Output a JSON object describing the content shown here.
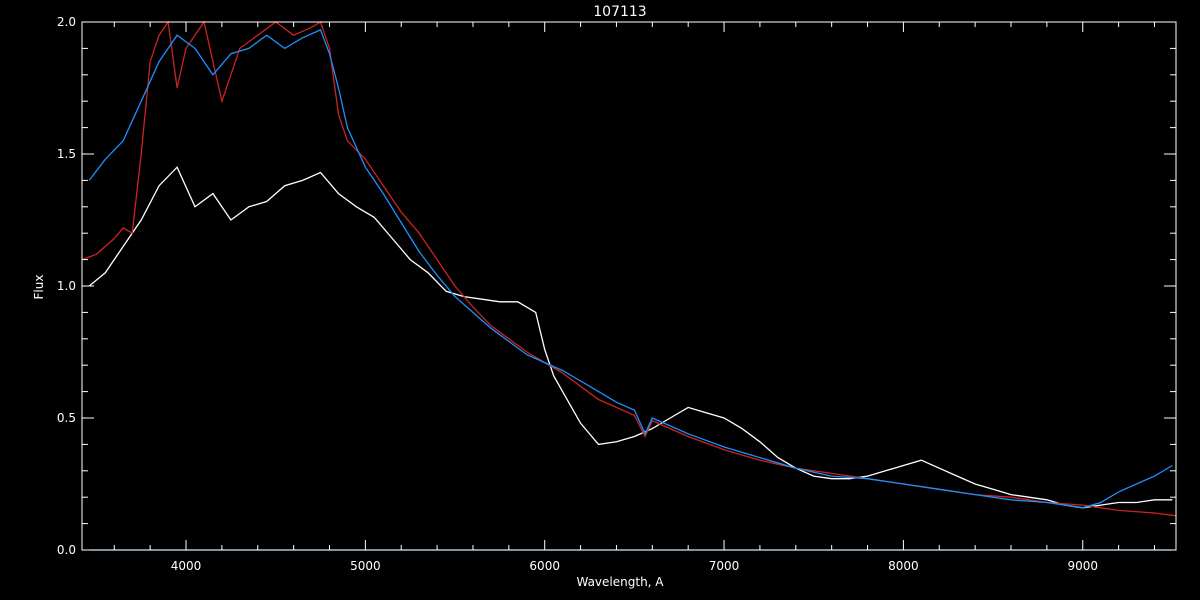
{
  "chart_data": {
    "type": "line",
    "title": "107113",
    "xlabel": "Wavelength, A",
    "ylabel": "Flux",
    "xlim": [
      3420,
      9520
    ],
    "ylim": [
      0.0,
      2.0
    ],
    "xticks": [
      4000,
      5000,
      6000,
      7000,
      8000,
      9000
    ],
    "xtick_labels": [
      "4000",
      "5000",
      "6000",
      "7000",
      "8000",
      "9000"
    ],
    "yticks": [
      0.0,
      0.5,
      1.0,
      1.5,
      2.0
    ],
    "ytick_labels": [
      "0.0",
      "0.5",
      "1.0",
      "1.5",
      "2.0"
    ],
    "grid": false,
    "background": "#000000",
    "series": [
      {
        "color": "#ffffff",
        "x": [
          3460,
          3550,
          3650,
          3750,
          3850,
          3950,
          4050,
          4150,
          4250,
          4350,
          4450,
          4550,
          4650,
          4750,
          4850,
          4950,
          5050,
          5150,
          5250,
          5350,
          5450,
          5550,
          5650,
          5750,
          5850,
          5950,
          6000,
          6050,
          6100,
          6200,
          6300,
          6400,
          6500,
          6600,
          6700,
          6800,
          6900,
          7000,
          7100,
          7200,
          7300,
          7400,
          7500,
          7600,
          7700,
          7800,
          7900,
          8000,
          8100,
          8200,
          8300,
          8400,
          8500,
          8600,
          8700,
          8800,
          8900,
          9000,
          9100,
          9200,
          9300,
          9400,
          9500
        ],
        "y": [
          1.0,
          1.05,
          1.15,
          1.25,
          1.38,
          1.45,
          1.3,
          1.35,
          1.25,
          1.3,
          1.32,
          1.38,
          1.4,
          1.43,
          1.35,
          1.3,
          1.26,
          1.18,
          1.1,
          1.05,
          0.98,
          0.96,
          0.95,
          0.94,
          0.94,
          0.9,
          0.76,
          0.66,
          0.6,
          0.48,
          0.4,
          0.41,
          0.43,
          0.46,
          0.5,
          0.54,
          0.52,
          0.5,
          0.46,
          0.41,
          0.35,
          0.31,
          0.28,
          0.27,
          0.27,
          0.28,
          0.3,
          0.32,
          0.34,
          0.31,
          0.28,
          0.25,
          0.23,
          0.21,
          0.2,
          0.19,
          0.17,
          0.16,
          0.17,
          0.18,
          0.18,
          0.19,
          0.19
        ]
      },
      {
        "color": "#cc2222",
        "x": [
          3420,
          3500,
          3550,
          3600,
          3650,
          3700,
          3750,
          3800,
          3850,
          3900,
          3950,
          4000,
          4100,
          4200,
          4300,
          4400,
          4500,
          4600,
          4700,
          4750,
          4800,
          4850,
          4900,
          5000,
          5100,
          5200,
          5300,
          5400,
          5500,
          5600,
          5700,
          5800,
          5900,
          6000,
          6100,
          6200,
          6300,
          6400,
          6500,
          6560,
          6600,
          6700,
          6800,
          7000,
          7200,
          7400,
          7600,
          7800,
          8000,
          8200,
          8400,
          8600,
          8800,
          9000,
          9200,
          9400,
          9520
        ],
        "y": [
          1.1,
          1.12,
          1.15,
          1.18,
          1.22,
          1.2,
          1.5,
          1.85,
          1.95,
          2.0,
          1.75,
          1.9,
          2.0,
          1.7,
          1.9,
          1.95,
          2.0,
          1.95,
          1.98,
          2.0,
          1.9,
          1.65,
          1.55,
          1.48,
          1.38,
          1.28,
          1.2,
          1.1,
          1.0,
          0.92,
          0.85,
          0.8,
          0.75,
          0.71,
          0.67,
          0.62,
          0.57,
          0.54,
          0.51,
          0.43,
          0.49,
          0.46,
          0.43,
          0.38,
          0.34,
          0.31,
          0.29,
          0.27,
          0.25,
          0.23,
          0.21,
          0.2,
          0.18,
          0.17,
          0.15,
          0.14,
          0.13
        ]
      },
      {
        "color": "#1e90ff",
        "x": [
          3460,
          3550,
          3650,
          3750,
          3850,
          3950,
          4050,
          4150,
          4250,
          4350,
          4450,
          4550,
          4650,
          4750,
          4800,
          4850,
          4900,
          5000,
          5100,
          5200,
          5300,
          5400,
          5500,
          5600,
          5700,
          5800,
          5900,
          6000,
          6100,
          6200,
          6300,
          6400,
          6500,
          6560,
          6600,
          6700,
          6800,
          7000,
          7200,
          7400,
          7600,
          7800,
          8000,
          8200,
          8400,
          8600,
          8800,
          9000,
          9100,
          9200,
          9300,
          9400,
          9500
        ],
        "y": [
          1.4,
          1.48,
          1.55,
          1.7,
          1.85,
          1.95,
          1.9,
          1.8,
          1.88,
          1.9,
          1.95,
          1.9,
          1.94,
          1.97,
          1.88,
          1.75,
          1.6,
          1.45,
          1.35,
          1.24,
          1.13,
          1.04,
          0.96,
          0.9,
          0.84,
          0.79,
          0.74,
          0.71,
          0.68,
          0.64,
          0.6,
          0.56,
          0.53,
          0.44,
          0.5,
          0.47,
          0.44,
          0.39,
          0.35,
          0.31,
          0.28,
          0.27,
          0.25,
          0.23,
          0.21,
          0.19,
          0.18,
          0.16,
          0.18,
          0.22,
          0.25,
          0.28,
          0.32
        ]
      },
      {
        "color": "#1e90ff",
        "x": [
          3460,
          9500
        ],
        "y": [
          0.0,
          0.0
        ]
      }
    ]
  }
}
